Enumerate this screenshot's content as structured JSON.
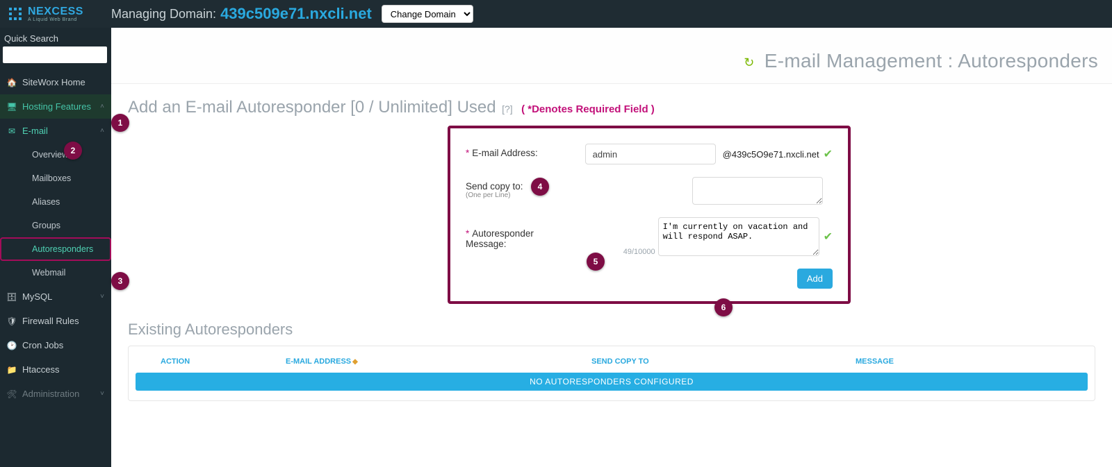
{
  "brand": {
    "name": "NEXCESS",
    "tagline": "A Liquid Web Brand"
  },
  "topbar": {
    "managing_label": "Managing Domain:",
    "domain": "439c509e71.nxcli.net",
    "change_domain_label": "Change Domain"
  },
  "sidebar": {
    "quick_search_label": "Quick Search",
    "items": {
      "home": "SiteWorx Home",
      "hosting": "Hosting Features",
      "email": "E-mail",
      "email_children": {
        "overview": "Overview",
        "mailboxes": "Mailboxes",
        "aliases": "Aliases",
        "groups": "Groups",
        "autoresponders": "Autoresponders",
        "webmail": "Webmail"
      },
      "mysql": "MySQL",
      "firewall": "Firewall Rules",
      "cron": "Cron Jobs",
      "htaccess": "Htaccess",
      "admin": "Administration"
    }
  },
  "page": {
    "title": "E-mail Management : Autoresponders",
    "form_title": "Add an E-mail Autoresponder [0 / Unlimited] Used",
    "help_marker": "[?]",
    "required_note": "( *Denotes Required Field )"
  },
  "form": {
    "email_label": "E-mail Address:",
    "email_value": "admin",
    "email_suffix": "@439c5O9e71.nxcli.net",
    "copy_label": "Send copy to:",
    "copy_hint": "(One per Line)",
    "msg_label": "Autoresponder Message:",
    "msg_value": "I'm currently on vacation and will respond ASAP.",
    "char_count": "49/10000",
    "add_button": "Add"
  },
  "existing": {
    "title": "Existing Autoresponders",
    "columns": {
      "action": "ACTION",
      "email": "E-MAIL ADDRESS",
      "copy": "SEND COPY TO",
      "message": "MESSAGE"
    },
    "empty": "NO AUTORESPONDERS CONFIGURED"
  },
  "badges": {
    "b1": "1",
    "b2": "2",
    "b3": "3",
    "b4": "4",
    "b5": "5",
    "b6": "6"
  }
}
